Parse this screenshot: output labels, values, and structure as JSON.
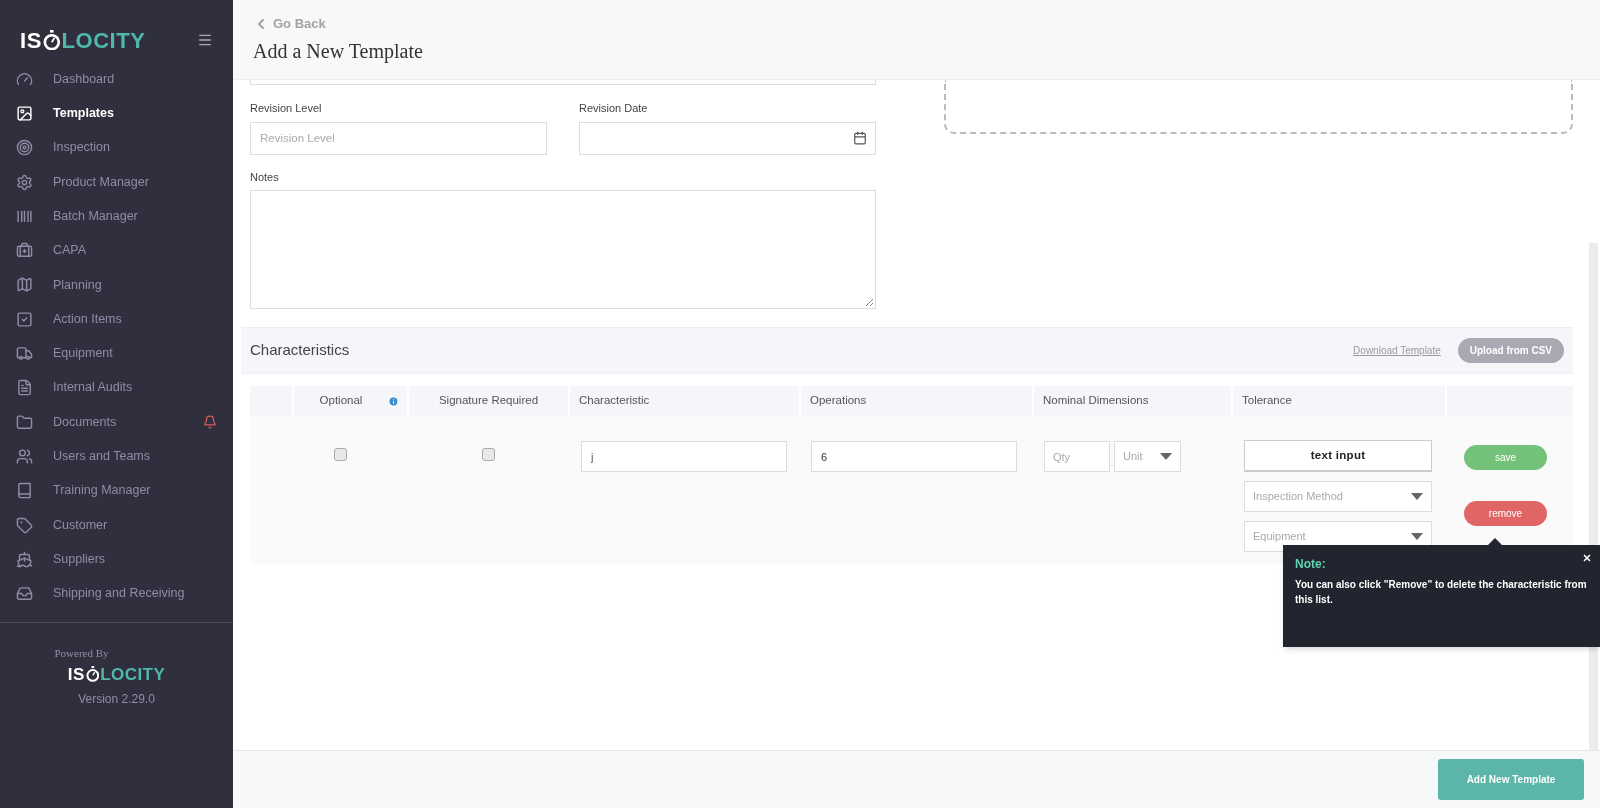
{
  "sidebar": {
    "logo": {
      "left": "IS",
      "right": "LOCITY"
    },
    "items": [
      {
        "label": "Dashboard",
        "selected": false,
        "alert": false
      },
      {
        "label": "Templates",
        "selected": true,
        "alert": false
      },
      {
        "label": "Inspection",
        "selected": false,
        "alert": false
      },
      {
        "label": "Product Manager",
        "selected": false,
        "alert": false
      },
      {
        "label": "Batch Manager",
        "selected": false,
        "alert": false
      },
      {
        "label": "CAPA",
        "selected": false,
        "alert": false
      },
      {
        "label": "Planning",
        "selected": false,
        "alert": false
      },
      {
        "label": "Action Items",
        "selected": false,
        "alert": false
      },
      {
        "label": "Equipment",
        "selected": false,
        "alert": false
      },
      {
        "label": "Internal Audits",
        "selected": false,
        "alert": false
      },
      {
        "label": "Documents",
        "selected": false,
        "alert": true
      },
      {
        "label": "Users and Teams",
        "selected": false,
        "alert": false
      },
      {
        "label": "Training Manager",
        "selected": false,
        "alert": false
      },
      {
        "label": "Customer",
        "selected": false,
        "alert": false
      },
      {
        "label": "Suppliers",
        "selected": false,
        "alert": false
      },
      {
        "label": "Shipping and Receiving",
        "selected": false,
        "alert": false
      }
    ],
    "footer": {
      "powered_by": "Powered By",
      "logo": {
        "left": "IS",
        "right": "LOCITY"
      },
      "version": "Version 2.29.0"
    }
  },
  "header": {
    "back_link": "Go Back",
    "title": "Add a New Template"
  },
  "form": {
    "fields": [
      {
        "label": "Revision Level",
        "placeholder": "Revision Level",
        "kind": "text"
      },
      {
        "label": "Revision Date",
        "kind": "date"
      }
    ],
    "notes": {
      "label": "Notes"
    }
  },
  "characteristics": {
    "title": "Characteristics",
    "download_link": "Download Template",
    "upload_button": "Upload from CSV",
    "columns": [
      {
        "label": "Optional",
        "info": true
      },
      {
        "label": "Signature Required",
        "info": false
      },
      {
        "label": "Characteristic",
        "info": false
      },
      {
        "label": "Operations",
        "info": false
      },
      {
        "label": "Nominal Dimensions",
        "info": false
      },
      {
        "label": "Tolerance",
        "info": false
      }
    ],
    "row": {
      "optional": false,
      "signature_required": false,
      "characteristic": "j",
      "operations": "6",
      "qty_placeholder": "Qty",
      "unit_placeholder": "Unit",
      "tolerance_button": "text input",
      "inspection_method_placeholder": "Inspection Method",
      "equipment_placeholder": "Equipment",
      "save_button": "save",
      "remove_button": "remove"
    }
  },
  "tooltip": {
    "title": "Note:",
    "text": "You can also click \"Remove\" to delete the characteristic from this list."
  },
  "footer": {
    "submit_button": "Add New Template"
  }
}
